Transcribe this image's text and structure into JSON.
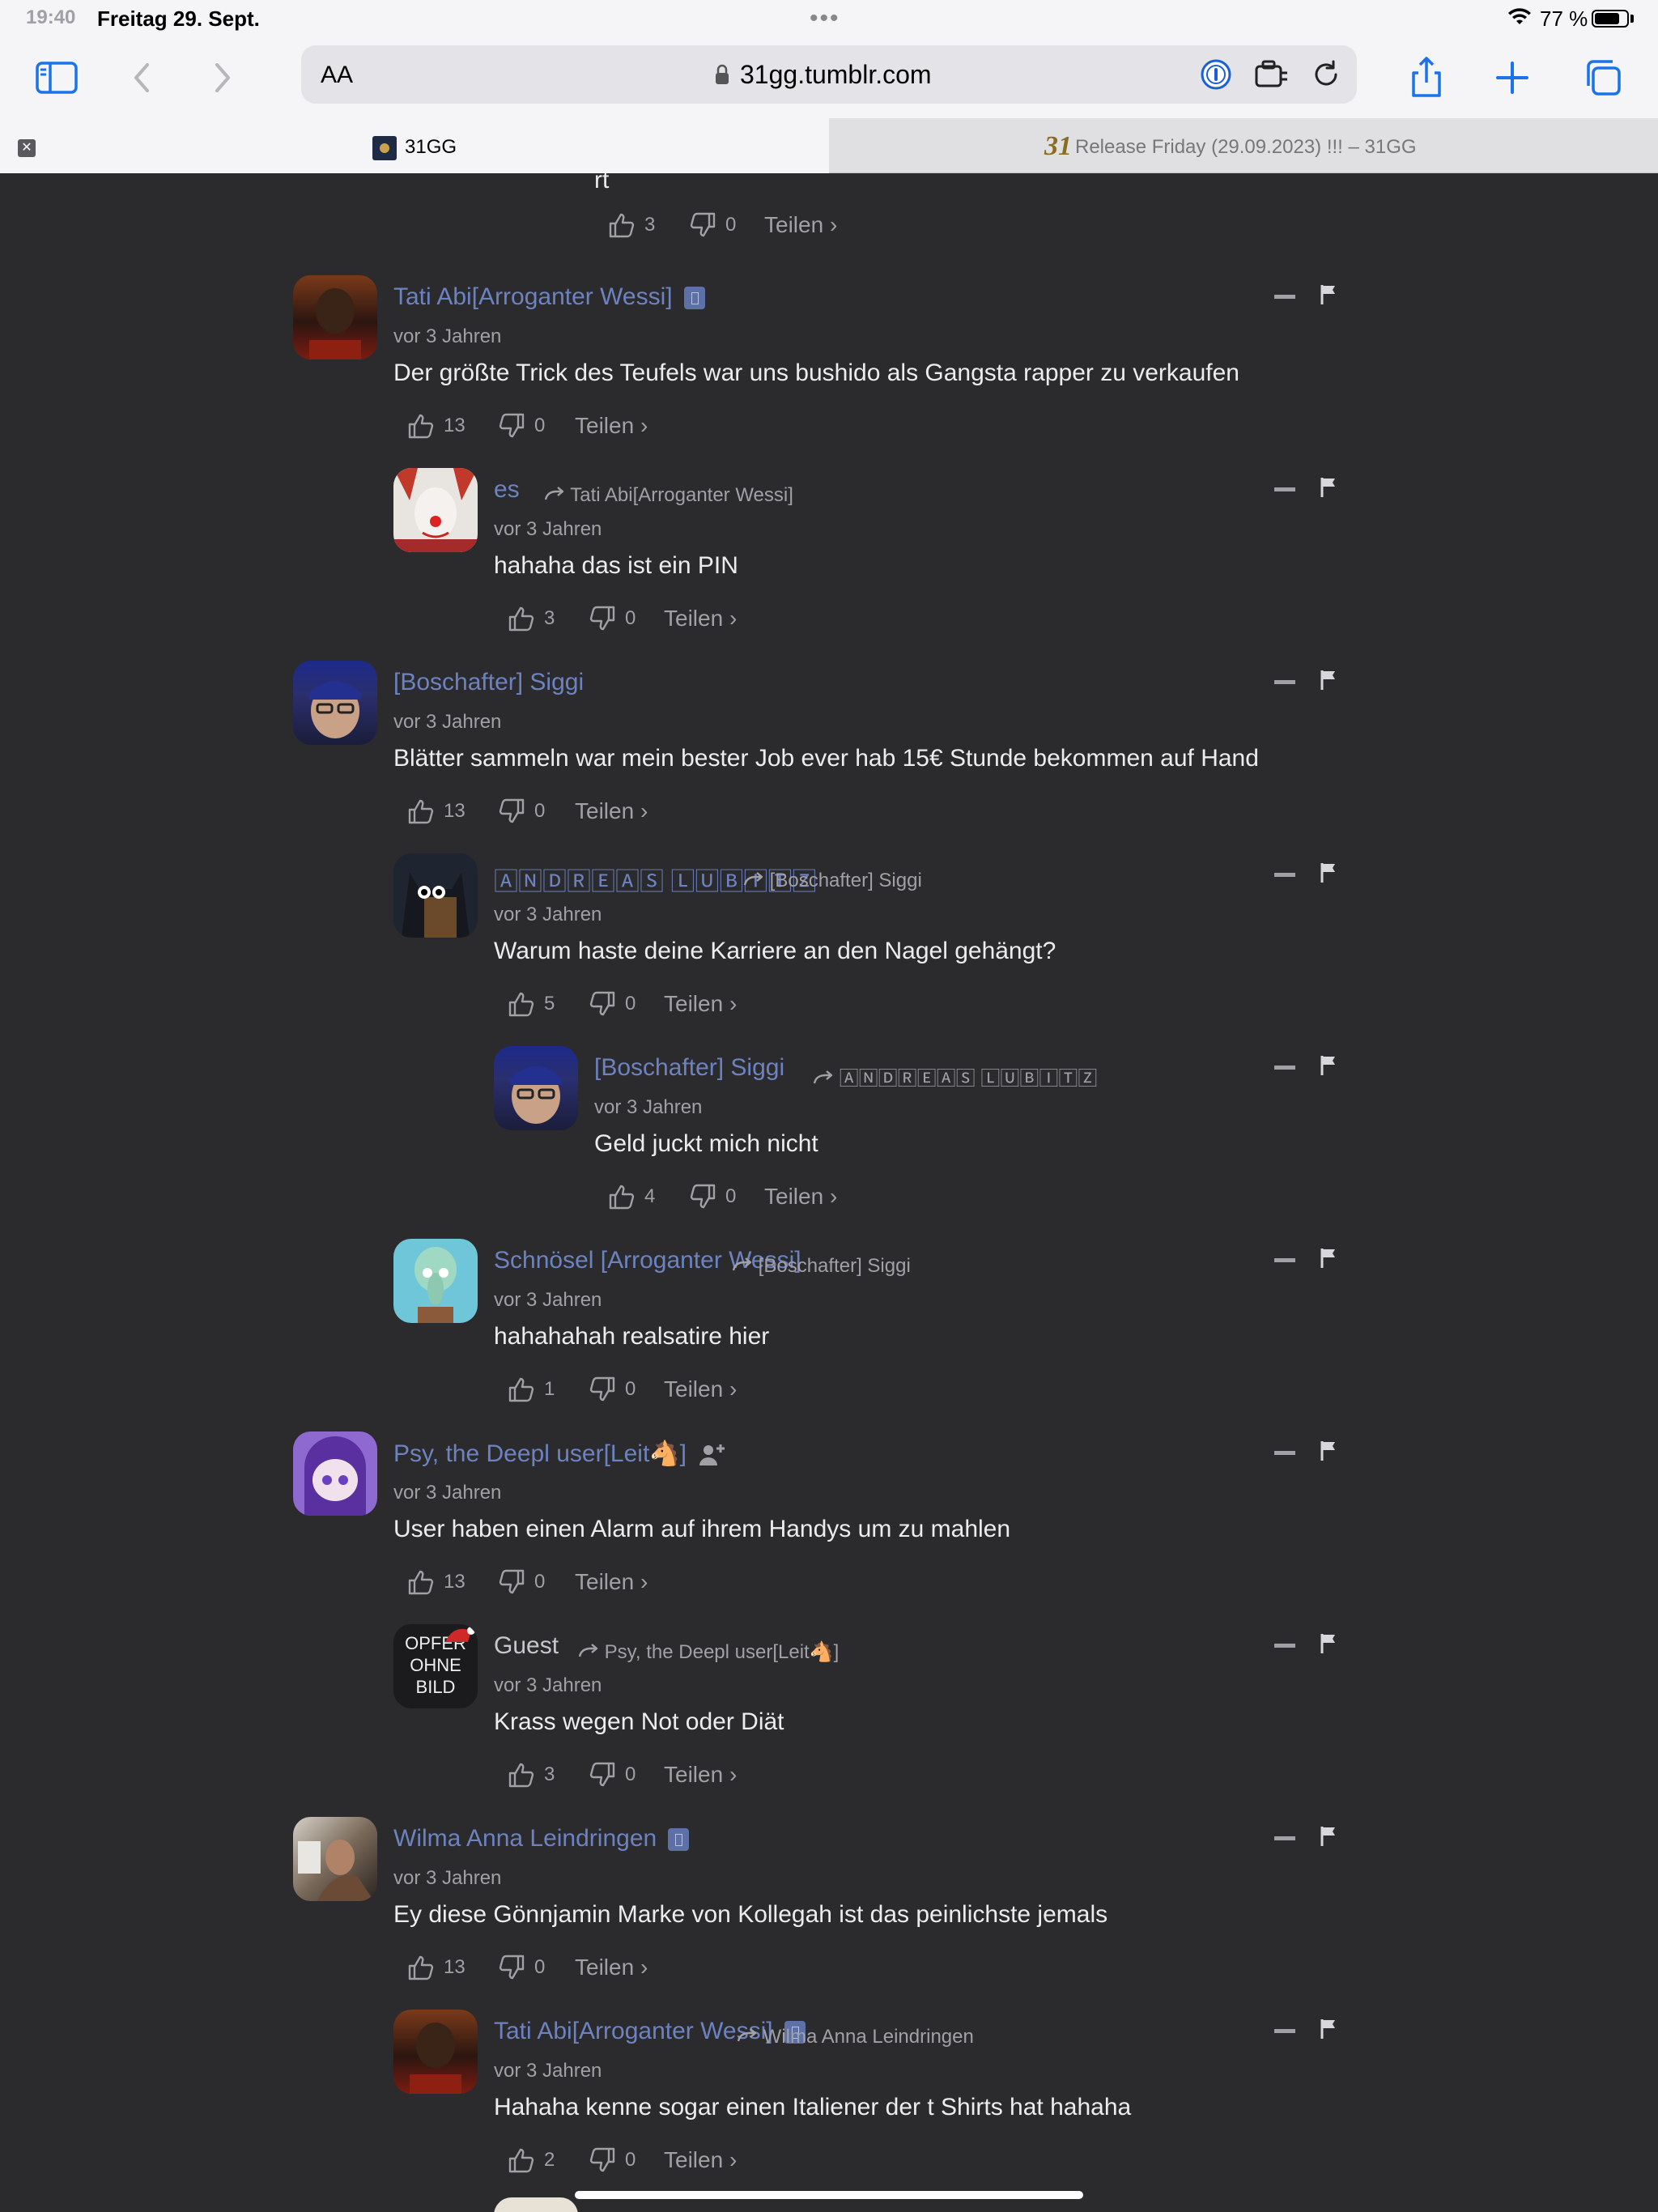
{
  "status": {
    "time": "19:40",
    "date": "Freitag 29. Sept.",
    "battery": "77 %"
  },
  "toolbar": {
    "aa": "AA",
    "url": "31gg.tumblr.com"
  },
  "tabs": [
    {
      "title": "31GG"
    },
    {
      "fav": "31",
      "title": "Release Friday (29.09.2023) !!! – 31GG"
    }
  ],
  "top_fragment": {
    "text": "rt",
    "likes": "3",
    "dislikes": "0",
    "share": "Teilen ›"
  },
  "comments": [
    {
      "author": "Tati Abi[Arroganter Wessi]",
      "time": "vor 3 Jahren",
      "text": "Der größte Trick des Teufels war uns bushido als Gangsta rapper zu verkaufen",
      "likes": "13",
      "dislikes": "0",
      "share": "Teilen ›"
    },
    {
      "author": "es",
      "reply_to": "Tati Abi[Arroganter Wessi]",
      "time": "vor 3 Jahren",
      "text": "hahaha das ist ein PIN",
      "likes": "3",
      "dislikes": "0",
      "share": "Teilen ›"
    },
    {
      "author": "[Boschafter] Siggi",
      "time": "vor 3 Jahren",
      "text": "Blätter sammeln war mein bester Job ever hab 15€ Stunde bekommen auf Hand",
      "likes": "13",
      "dislikes": "0",
      "share": "Teilen ›"
    },
    {
      "author": "🄰🄽🄳🅁🄴🄰🅂 🄻🅄🄱🄸🅃🅉",
      "reply_to": "[Boschafter] Siggi",
      "time": "vor 3 Jahren",
      "text": "Warum haste deine Karriere an den Nagel gehängt?",
      "likes": "5",
      "dislikes": "0",
      "share": "Teilen ›"
    },
    {
      "author": "[Boschafter] Siggi",
      "reply_to": "🄰🄽🄳🅁🄴🄰🅂 🄻🅄🄱🄸🅃🅉",
      "time": "vor 3 Jahren",
      "text": "Geld juckt mich nicht",
      "likes": "4",
      "dislikes": "0",
      "share": "Teilen ›"
    },
    {
      "author": "Schnösel [Arroganter Wessi]",
      "reply_to": "[Boschafter] Siggi",
      "time": "vor 3 Jahren",
      "text": "hahahahah realsatire hier",
      "likes": "1",
      "dislikes": "0",
      "share": "Teilen ›"
    },
    {
      "author": "Psy, the Deepl user[Leit🐴]",
      "time": "vor 3 Jahren",
      "text": "User haben einen Alarm auf ihrem Handys um zu mahlen",
      "likes": "13",
      "dislikes": "0",
      "share": "Teilen ›"
    },
    {
      "author": "Guest",
      "reply_to": "Psy, the Deepl user[Leit🐴]",
      "avatar_text": "OPFER OHNE BILD",
      "time": "vor 3 Jahren",
      "text": "Krass wegen Not oder Diät",
      "likes": "3",
      "dislikes": "0",
      "share": "Teilen ›"
    },
    {
      "author": "Wilma Anna Leindringen",
      "time": "vor 3 Jahren",
      "text": "Ey diese Gönnjamin Marke von Kollegah ist das peinlichste jemals",
      "likes": "13",
      "dislikes": "0",
      "share": "Teilen ›"
    },
    {
      "author": "Tati Abi[Arroganter Wessi]",
      "reply_to": "Wilma Anna Leindringen",
      "time": "vor 3 Jahren",
      "text": "Hahaha kenne sogar einen Italiener der t Shirts hat hahaha",
      "likes": "2",
      "dislikes": "0",
      "share": "Teilen ›"
    }
  ]
}
